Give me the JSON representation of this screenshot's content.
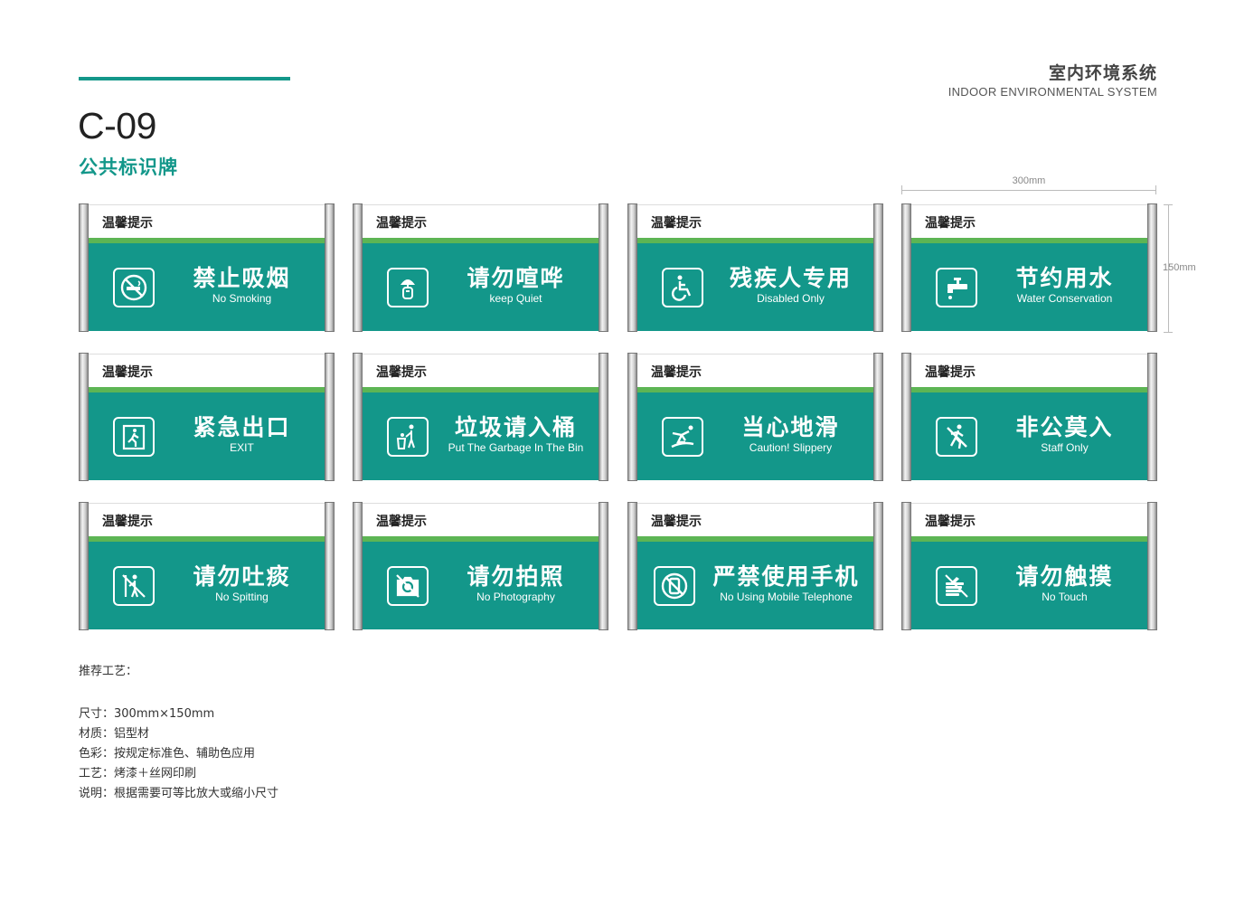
{
  "header": {
    "code": "C-09",
    "subtitle": "公共标识牌",
    "system_cn": "室内环境系统",
    "system_en": "INDOOR ENVIRONMENTAL SYSTEM"
  },
  "dimensions": {
    "width_label": "300mm",
    "height_label": "150mm"
  },
  "colors": {
    "primary": "#13978a",
    "stripe": "#5db554",
    "rail": "#c8c8c8"
  },
  "signs": [
    {
      "tag": "温馨提示",
      "title_cn": "禁止吸烟",
      "title_en": "No Smoking",
      "icon": "no-smoking-icon"
    },
    {
      "tag": "温馨提示",
      "title_cn": "请勿喧哗",
      "title_en": "keep Quiet",
      "icon": "keep-quiet-icon"
    },
    {
      "tag": "温馨提示",
      "title_cn": "残疾人专用",
      "title_en": "Disabled Only",
      "icon": "wheelchair-icon"
    },
    {
      "tag": "温馨提示",
      "title_cn": "节约用水",
      "title_en": "Water Conservation",
      "icon": "faucet-icon"
    },
    {
      "tag": "温馨提示",
      "title_cn": "紧急出口",
      "title_en": "EXIT",
      "icon": "exit-icon"
    },
    {
      "tag": "温馨提示",
      "title_cn": "垃圾请入桶",
      "title_en": "Put The Garbage In The Bin",
      "icon": "trash-bin-icon"
    },
    {
      "tag": "温馨提示",
      "title_cn": "当心地滑",
      "title_en": "Caution!  Slippery",
      "icon": "slippery-floor-icon"
    },
    {
      "tag": "温馨提示",
      "title_cn": "非公莫入",
      "title_en": "Staff  Only",
      "icon": "staff-only-icon"
    },
    {
      "tag": "温馨提示",
      "title_cn": "请勿吐痰",
      "title_en": "No  Spitting",
      "icon": "no-spitting-icon"
    },
    {
      "tag": "温馨提示",
      "title_cn": "请勿拍照",
      "title_en": "No  Photography",
      "icon": "no-photography-icon"
    },
    {
      "tag": "温馨提示",
      "title_cn": "严禁使用手机",
      "title_en": "No Using Mobile Telephone",
      "icon": "no-mobile-phone-icon"
    },
    {
      "tag": "温馨提示",
      "title_cn": "请勿触摸",
      "title_en": "No Touch",
      "icon": "no-touch-icon"
    }
  ],
  "notes": {
    "title": "推荐工艺：",
    "size": "尺寸：300mm×150mm",
    "material": "材质：铝型材",
    "color": "色彩：按规定标准色、辅助色应用",
    "process": "工艺：烤漆＋丝网印刷",
    "description": "说明：根据需要可等比放大或缩小尺寸"
  }
}
